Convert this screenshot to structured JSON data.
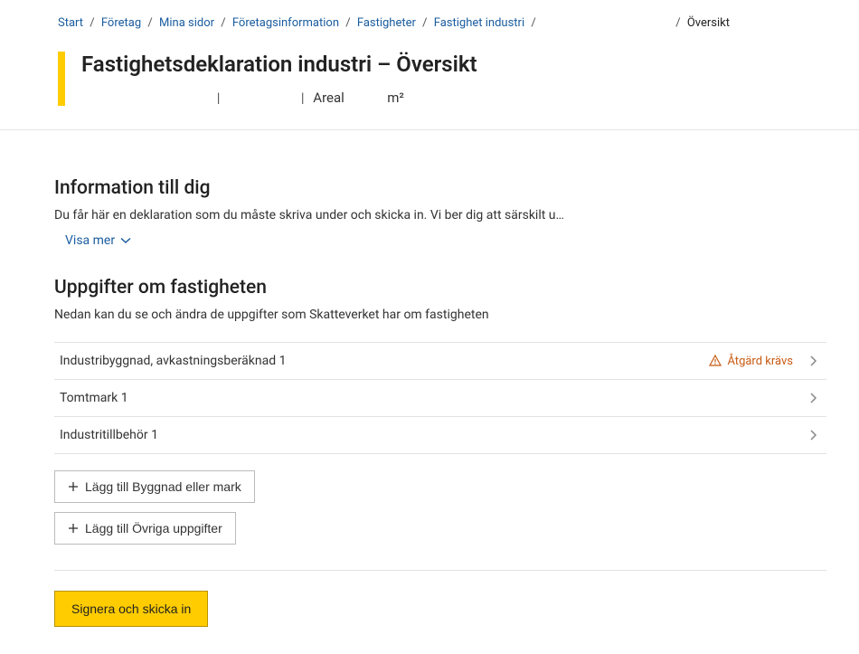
{
  "breadcrumb": {
    "items": [
      {
        "label": "Start"
      },
      {
        "label": "Företag"
      },
      {
        "label": "Mina sidor"
      },
      {
        "label": "Företagsinformation"
      },
      {
        "label": "Fastigheter"
      },
      {
        "label": "Fastighet industri"
      }
    ],
    "current": "Översikt"
  },
  "header": {
    "title": "Fastighetsdeklaration industri – Översikt",
    "meta_areal_label": "Areal",
    "meta_unit": "m²"
  },
  "info_section": {
    "heading": "Information till dig",
    "desc": "Du får här en deklaration som du måste skriva under och skicka in. Vi ber dig att särskilt u…",
    "expand_label": "Visa mer"
  },
  "details_section": {
    "heading": "Uppgifter om fastigheten",
    "desc": "Nedan kan du se och ändra de uppgifter som Skatteverket har om fastigheten",
    "rows": [
      {
        "label": "Industribyggnad, avkastningsberäknad 1",
        "badge": "Åtgärd krävs"
      },
      {
        "label": "Tomtmark 1",
        "badge": ""
      },
      {
        "label": "Industritillbehör 1",
        "badge": ""
      }
    ]
  },
  "actions": {
    "add_building": "Lägg till Byggnad eller mark",
    "add_other": "Lägg till Övriga uppgifter",
    "submit": "Signera och skicka in"
  }
}
